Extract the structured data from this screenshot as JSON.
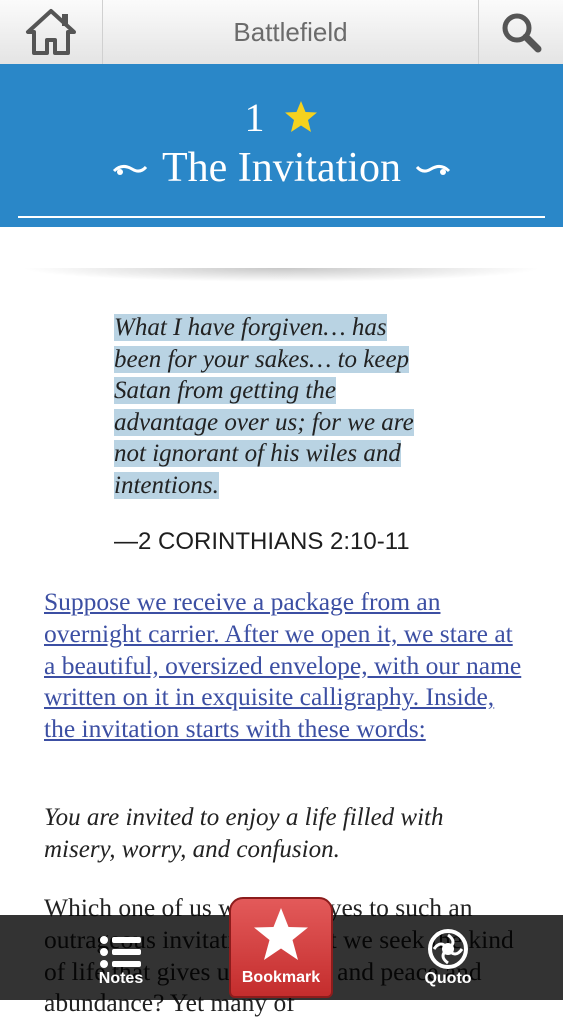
{
  "header": {
    "title": "Battlefield",
    "home_icon": "home-icon",
    "search_icon": "search-icon"
  },
  "chapter": {
    "number": "1",
    "title": "The Invitation",
    "accent_color": "#2a87c8",
    "star_color": "#f5d21e"
  },
  "content": {
    "epigraph_lines": [
      "What I have forgiven… has",
      "been for your sakes… to keep",
      "Satan from getting the",
      "advantage over us; for we are",
      "not ignorant of his wiles and",
      "intentions."
    ],
    "reference": "—2 CORINTHIANS 2:10-11",
    "paragraph_link": "Suppose we receive a package from an overnight carrier. After we open it, we stare at a beautiful, oversized envelope, with our name written on it in exquisite calligraphy. Inside, the invitation starts with these words:",
    "paragraph_italic": "You are invited to enjoy a life filled with misery, worry, and confusion.",
    "paragraph_body": "Which one of us would say yes to such an outrageous invitation? Don’t we seek the kind of life that gives us freedom and peace and abundance? Yet many of"
  },
  "bottom_bar": {
    "notes_label": "Notes",
    "bookmark_label": "Bookmark",
    "quoto_label": "Quoto",
    "bookmark_color": "#d43c3c"
  }
}
